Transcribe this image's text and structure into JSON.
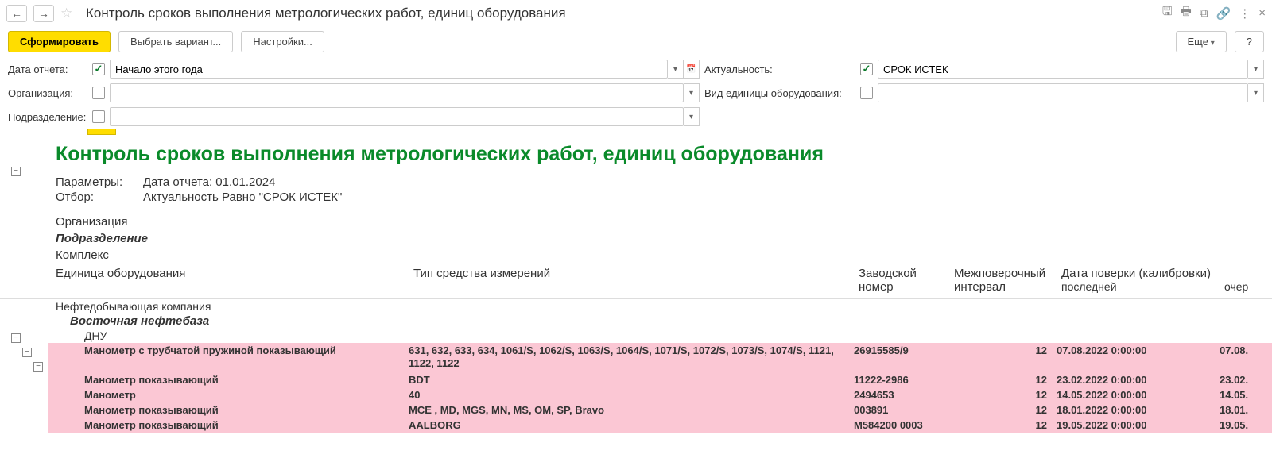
{
  "header": {
    "title": "Контроль сроков выполнения метрологических работ, единиц оборудования"
  },
  "toolbar": {
    "form": "Сформировать",
    "variant": "Выбрать вариант...",
    "settings": "Настройки...",
    "more": "Еще",
    "help": "?"
  },
  "filters": {
    "date_label": "Дата отчета:",
    "date_value": "Начало этого года",
    "org_label": "Организация:",
    "org_value": "",
    "dept_label": "Подразделение:",
    "dept_value": "",
    "actual_label": "Актуальность:",
    "actual_value": "СРОК ИСТЕК",
    "eqtype_label": "Вид единицы оборудования:",
    "eqtype_value": ""
  },
  "report": {
    "title": "Контроль сроков выполнения метрологических работ, единиц оборудования",
    "param_label": "Параметры:",
    "param_value": "Дата отчета: 01.01.2024",
    "filter_label": "Отбор:",
    "filter_value": "Актуальность Равно \"СРОК ИСТЕК\"",
    "g_org": "Организация",
    "g_dept": "Подразделение",
    "g_complex": "Комплекс",
    "col_unit": "Единица оборудования",
    "col_type": "Тип средства измерений",
    "col_serial": "Заводской номер",
    "col_interval": "Межповерочный интервал",
    "col_date": "Дата поверки (калибровки)",
    "col_last": "последней",
    "col_next": "очер"
  },
  "tree": {
    "org": "Нефтедобывающая компания",
    "dept": "Восточная нефтебаза",
    "complex": "ДНУ"
  },
  "rows": [
    {
      "unit": "Манометр с трубчатой пружиной показывающий",
      "type": "631, 632, 633, 634, 1061/S, 1062/S, 1063/S, 1064/S, 1071/S, 1072/S, 1073/S, 1074/S, 1121, 1122, 1122",
      "serial": "26915585/9",
      "interval": "12",
      "last": "07.08.2022 0:00:00",
      "next": "07.08."
    },
    {
      "unit": "Манометр показывающий",
      "type": "BDT",
      "serial": "11222-2986",
      "interval": "12",
      "last": "23.02.2022 0:00:00",
      "next": "23.02."
    },
    {
      "unit": "Манометр",
      "type": "40",
      "serial": "2494653",
      "interval": "12",
      "last": "14.05.2022 0:00:00",
      "next": "14.05."
    },
    {
      "unit": "Манометр показывающий",
      "type": "MCE , MD, MGS, MN, MS, OM, SP, Bravo",
      "serial": "003891",
      "interval": "12",
      "last": "18.01.2022 0:00:00",
      "next": "18.01."
    },
    {
      "unit": "Манометр показывающий",
      "type": "AALBORG",
      "serial": "M584200 0003",
      "interval": "12",
      "last": "19.05.2022 0:00:00",
      "next": "19.05."
    }
  ]
}
